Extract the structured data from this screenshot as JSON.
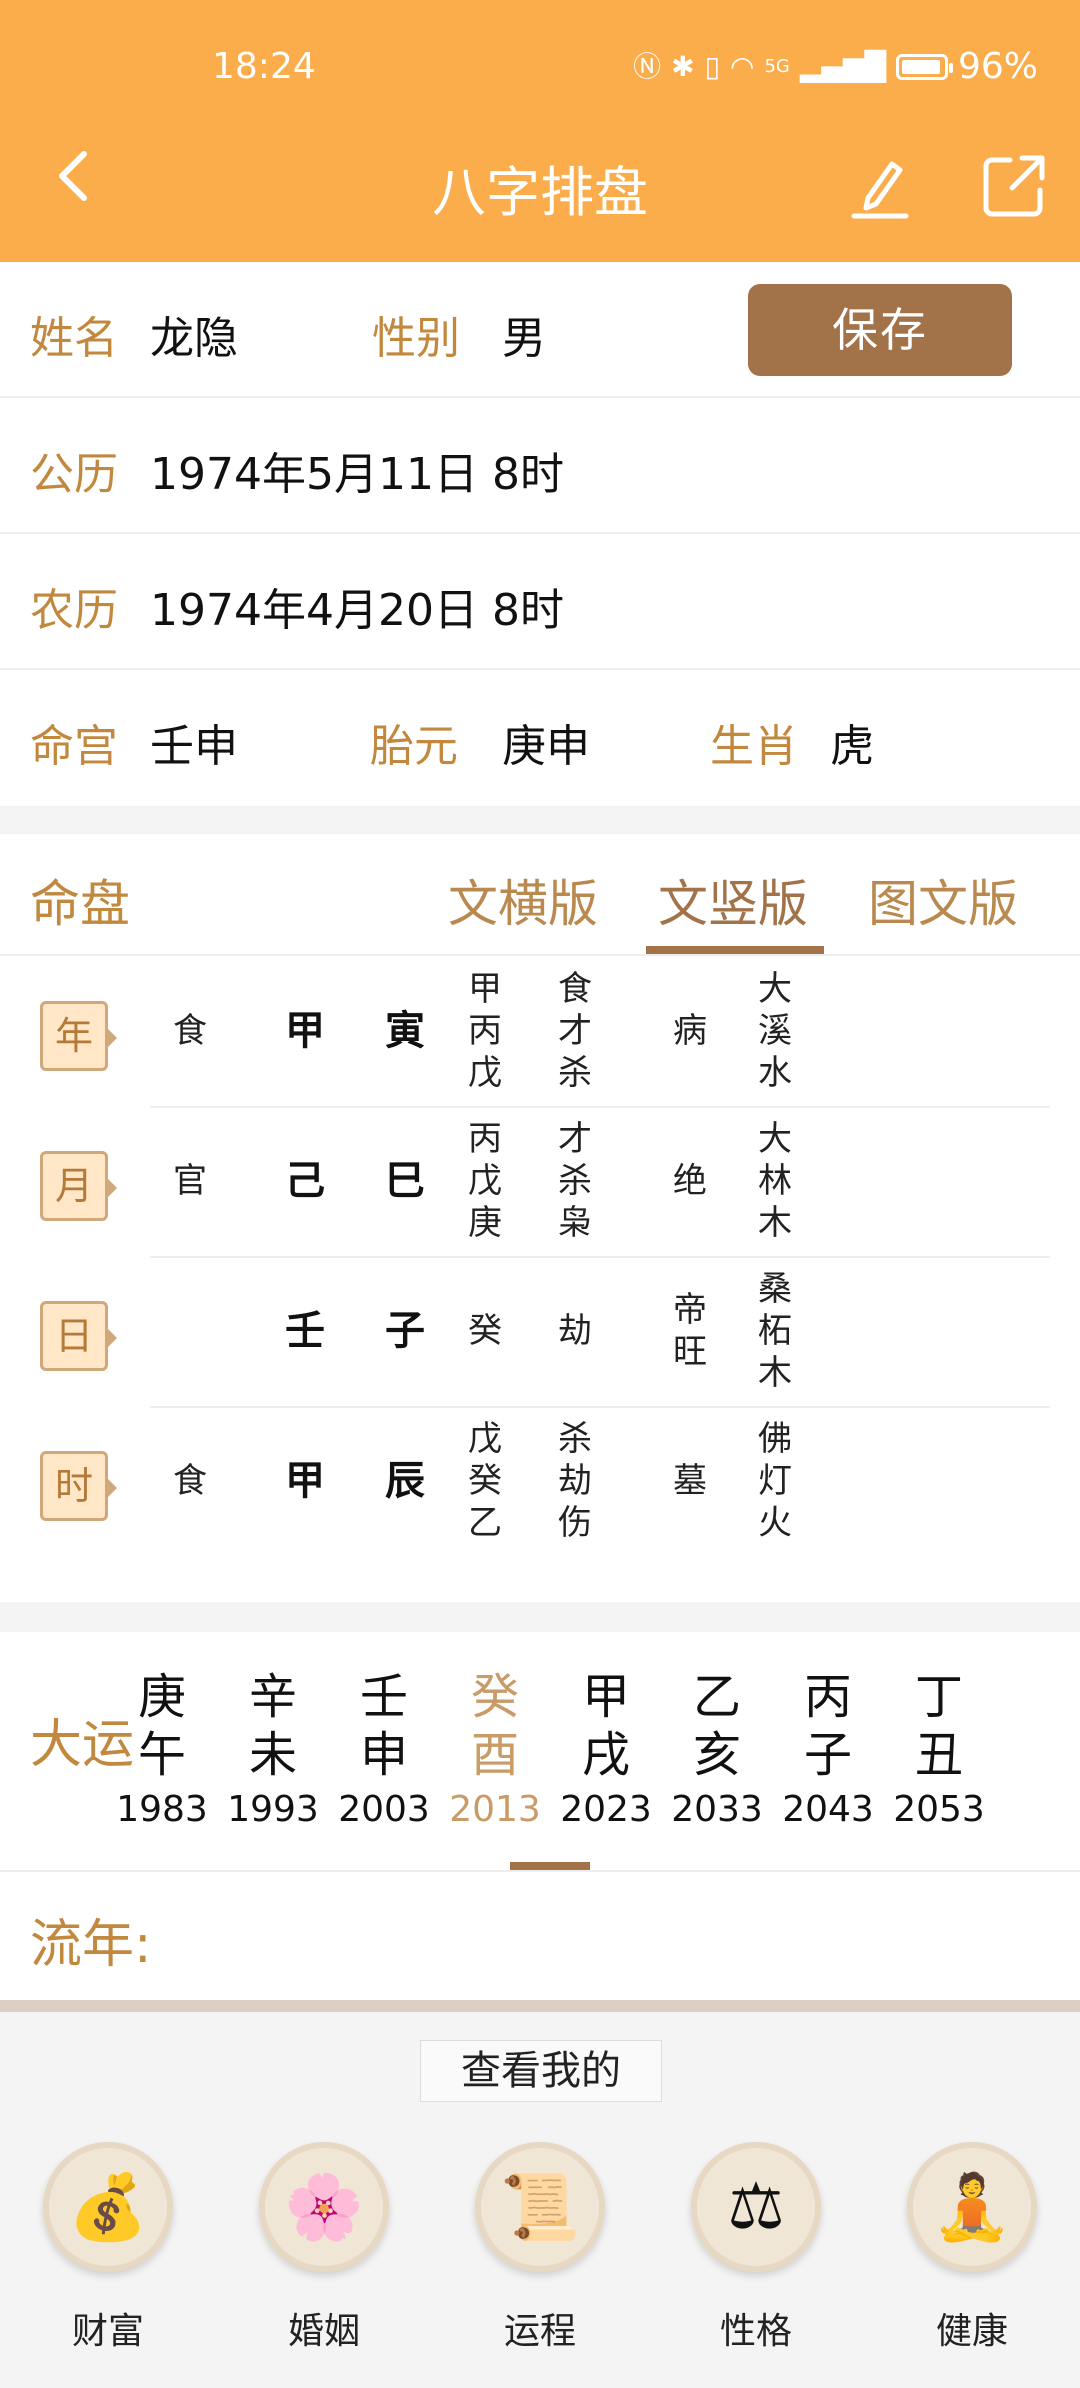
{
  "status_bar": {
    "time": "18:24",
    "network": "5G",
    "battery_text": "96%",
    "battery_level": 0.96
  },
  "header": {
    "title": "八字排盘"
  },
  "profile": {
    "name_label": "姓名",
    "name": "龙隐",
    "gender_label": "性别",
    "gender": "男",
    "save_label": "保存",
    "solar_label": "公历",
    "solar_date": "1974年5月11日 8时",
    "lunar_label": "农历",
    "lunar_date": "1974年4月20日 8时",
    "minggong_label": "命宫",
    "minggong": "壬申",
    "taiyuan_label": "胎元",
    "taiyuan": "庚申",
    "zodiac_label": "生肖",
    "zodiac": "虎"
  },
  "minpan": {
    "title": "命盘",
    "tabs": [
      "文横版",
      "文竖版",
      "图文版"
    ],
    "active_tab": "文竖版",
    "pillars": [
      {
        "tag": "年",
        "shishen": "食",
        "gan": "甲",
        "zhi": "寅",
        "canggan": [
          "甲",
          "丙",
          "戊"
        ],
        "fuxing": [
          "食",
          "才",
          "杀"
        ],
        "changsheng": "病",
        "nayin": [
          "大",
          "溪",
          "水"
        ]
      },
      {
        "tag": "月",
        "shishen": "官",
        "gan": "己",
        "zhi": "巳",
        "canggan": [
          "丙",
          "戊",
          "庚"
        ],
        "fuxing": [
          "才",
          "杀",
          "枭"
        ],
        "changsheng": "绝",
        "nayin": [
          "大",
          "林",
          "木"
        ]
      },
      {
        "tag": "日",
        "shishen": "",
        "gan": "壬",
        "zhi": "子",
        "canggan": [
          "癸"
        ],
        "fuxing": [
          "劫"
        ],
        "changsheng": "帝旺",
        "nayin": [
          "桑",
          "柘",
          "木"
        ]
      },
      {
        "tag": "时",
        "shishen": "食",
        "gan": "甲",
        "zhi": "辰",
        "canggan": [
          "戊",
          "癸",
          "乙"
        ],
        "fuxing": [
          "杀",
          "劫",
          "伤"
        ],
        "changsheng": "墓",
        "nayin": [
          "佛",
          "灯",
          "火"
        ]
      }
    ]
  },
  "dayun": {
    "label": "大运",
    "items": [
      {
        "gan": "庚",
        "zhi": "午",
        "year": "1983"
      },
      {
        "gan": "辛",
        "zhi": "未",
        "year": "1993"
      },
      {
        "gan": "壬",
        "zhi": "申",
        "year": "2003"
      },
      {
        "gan": "癸",
        "zhi": "酉",
        "year": "2013"
      },
      {
        "gan": "甲",
        "zhi": "戌",
        "year": "2023"
      },
      {
        "gan": "乙",
        "zhi": "亥",
        "year": "2033"
      },
      {
        "gan": "丙",
        "zhi": "子",
        "year": "2043"
      },
      {
        "gan": "丁",
        "zhi": "丑",
        "year": "2053"
      }
    ],
    "active_index": 3
  },
  "liunian": {
    "label": "流年:"
  },
  "bottom": {
    "view_mine": "查看我的",
    "features": [
      {
        "label": "财富",
        "icon": "gold-ingot-icon"
      },
      {
        "label": "婚姻",
        "icon": "peach-blossom-tree-icon"
      },
      {
        "label": "运程",
        "icon": "fortune-scroll-icon"
      },
      {
        "label": "性格",
        "icon": "balance-scale-icon"
      },
      {
        "label": "健康",
        "icon": "meditation-icon"
      }
    ]
  },
  "colors": {
    "header": "#fbac4b",
    "label": "#c1883e",
    "button": "#a27349",
    "active": "#c99b66"
  }
}
